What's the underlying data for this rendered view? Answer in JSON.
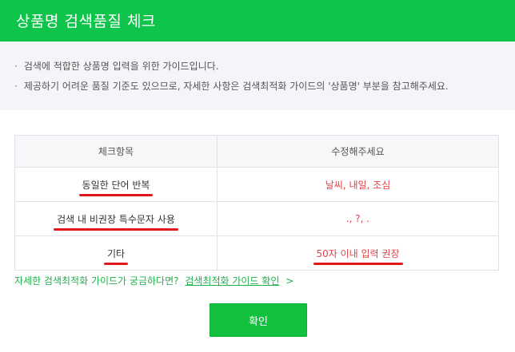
{
  "header": {
    "title": "상품명 검색품질 체크"
  },
  "notice": {
    "bullet": "·",
    "lines": [
      "검색에 적합한 상품명 입력을 위한 가이드입니다.",
      "제공하기 어려운 품질 기준도 있으므로, 자세한 사항은 검색최적화 가이드의 '상품명' 부분을 참고해주세요."
    ]
  },
  "table": {
    "headers": [
      "체크항목",
      "수정해주세요"
    ],
    "rows": [
      {
        "item": "동일한 단어 반복",
        "fix": "날씨, 내일, 조심"
      },
      {
        "item": "검색 내 비권장 특수문자 사용",
        "fix": "., ?, ."
      },
      {
        "item": "기타",
        "fix": "50자 이내 입력 권장"
      }
    ]
  },
  "guide": {
    "question": "자세한 검색최적화 가이드가 궁금하다면?",
    "link_label": "검색최적화 가이드 확인",
    "arrow": ">"
  },
  "confirm_label": "확인",
  "colors": {
    "accent": "#0fc44a",
    "highlight": "#e2434a",
    "underline": "#e0181b"
  }
}
